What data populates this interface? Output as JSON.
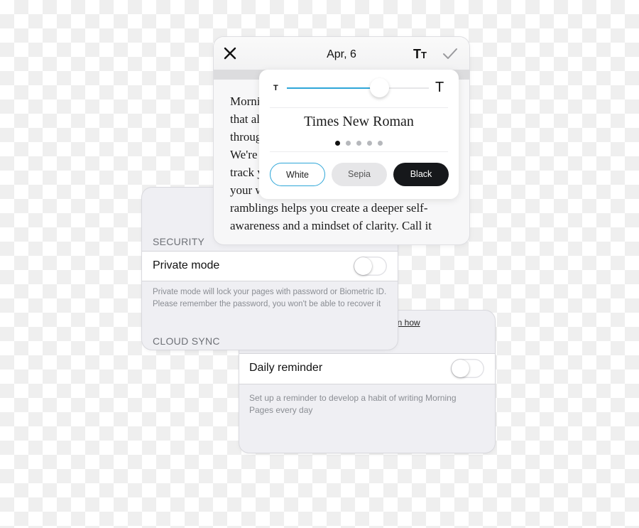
{
  "reminder_panel": {
    "learn_how_link": "arn how",
    "daily_reminder_label": "Daily reminder",
    "daily_reminder_on": false,
    "description": "Set up a reminder to develop a habit of writing Morning Pages every day"
  },
  "security_panel": {
    "security_header": "SECURITY",
    "private_mode_label": "Private mode",
    "private_mode_on": false,
    "description": "Private mode will lock your pages with password or Biometric ID. Please remember the password, you won't be able to recover it",
    "cloud_sync_header": "CLOUD SYNC"
  },
  "editor": {
    "title": "Apr, 6",
    "text_size_icon": "Tт",
    "body_lines": "Morni\nthat al\nthroug\nWe're\ntrack y\nyour w\nramblings helps you create a deeper self-\nawareness and a mindset of clarity. Call it"
  },
  "font_popover": {
    "small_t": "T",
    "large_t": "T",
    "font_size_fraction": 0.65,
    "font_name": "Times New Roman",
    "font_page_count": 5,
    "font_page_active": 0,
    "themes": [
      {
        "label": "White",
        "selected": true
      },
      {
        "label": "Sepia",
        "selected": false
      },
      {
        "label": "Black",
        "selected": false
      }
    ],
    "accent_color": "#2ea6d8"
  }
}
